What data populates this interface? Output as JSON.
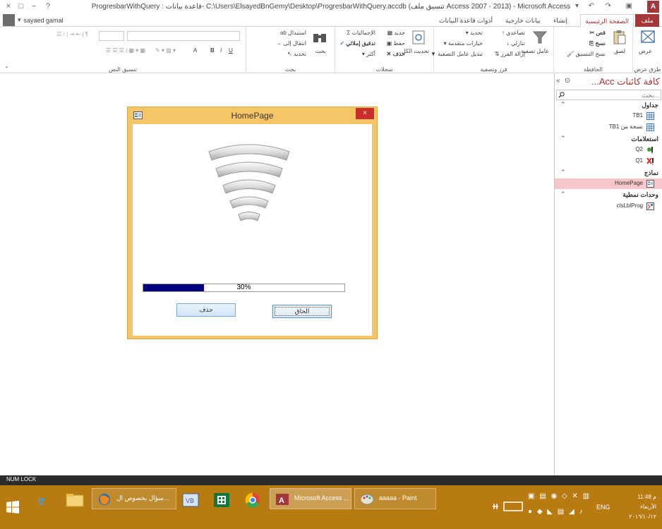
{
  "window": {
    "title": "ProgresbarWithQuery : قاعدة بيانات- C:\\Users\\ElsayedBnGemy\\Desktop\\ProgresbarWithQuery.accdb (تنسيق ملف Access 2007 - 2013) - Microsoft Access",
    "minimize": "−",
    "restore": "□",
    "close": "×",
    "help": "?"
  },
  "qat": {
    "save": "▣",
    "undo": "↶",
    "redo": "↷",
    "customize": "▾"
  },
  "user": {
    "name": "sayaed gamal"
  },
  "tabs": {
    "file": "ملف",
    "home": "الصفحة الرئيسية",
    "create": "إنشاء",
    "external": "بيانات خارجية",
    "dbtools": "أدوات قاعدة البيانات"
  },
  "ribbon": {
    "views": {
      "group": "طرق عرض",
      "view": "عرض"
    },
    "clipboard": {
      "group": "الحافظة",
      "paste": "لصق",
      "cut": "قص",
      "copy": "نسخ",
      "format_painter": "نسخ التنسيق"
    },
    "sort_filter": {
      "group": "فرز وتصفية",
      "filter": "عامل تصفية",
      "ascending": "تصاعدي",
      "descending": "تنازلي",
      "remove_sort": "إزالة الفرز",
      "selection": "تحديد",
      "advanced": "خيارات متقدمة",
      "toggle_filter": "تبديل عامل التصفية"
    },
    "records": {
      "group": "سجلات",
      "refresh": "تحديث الكل",
      "new": "جديد",
      "save": "حفظ",
      "delete": "حذف",
      "totals": "الإجماليات",
      "spelling": "تدقيق إملائي",
      "more": "أكثر"
    },
    "find": {
      "group": "بحث",
      "find": "بحث",
      "replace": "استبدال",
      "goto": "انتقال إلى",
      "select": "تحديد"
    },
    "text_format": {
      "group": "تنسيق النص",
      "bold": "B",
      "italic": "I",
      "underline": "U",
      "font_color": "A"
    }
  },
  "nav": {
    "title": "كافة كائنات Acc...",
    "search_placeholder": "بحث...",
    "categories": {
      "tables": "جداول",
      "queries": "استعلامات",
      "forms": "نماذج",
      "modules": "وحدات نمطية"
    },
    "items": {
      "tb1": "TB1",
      "tb1_copy": "نسخة من TB1",
      "q2": "Q2",
      "q1": "Q1",
      "homepage": "HomePage",
      "module": "clsLblProg"
    }
  },
  "form": {
    "title": "HomePage",
    "close": "×",
    "progress_text": "30%",
    "progress_value": 0.3,
    "btn_delete": "حذف",
    "btn_append": "الحاق"
  },
  "status": {
    "numlock": "NUM LOCK"
  },
  "taskbar": {
    "firefox_label": "سؤال بخصوص ال...",
    "access_label": "Microsoft Access ...",
    "paint_label": "aaaaa - Paint",
    "lang": "ENG",
    "time": "11:48 م",
    "day": "الأربعاء",
    "date": "٢٠١٦/١٠/١٢"
  },
  "colors": {
    "access_red": "#a4373a",
    "form_border": "#f5c668",
    "progress_fill": "#000080",
    "selected_item": "#f7c6ca",
    "taskbar": "#b87b12"
  }
}
